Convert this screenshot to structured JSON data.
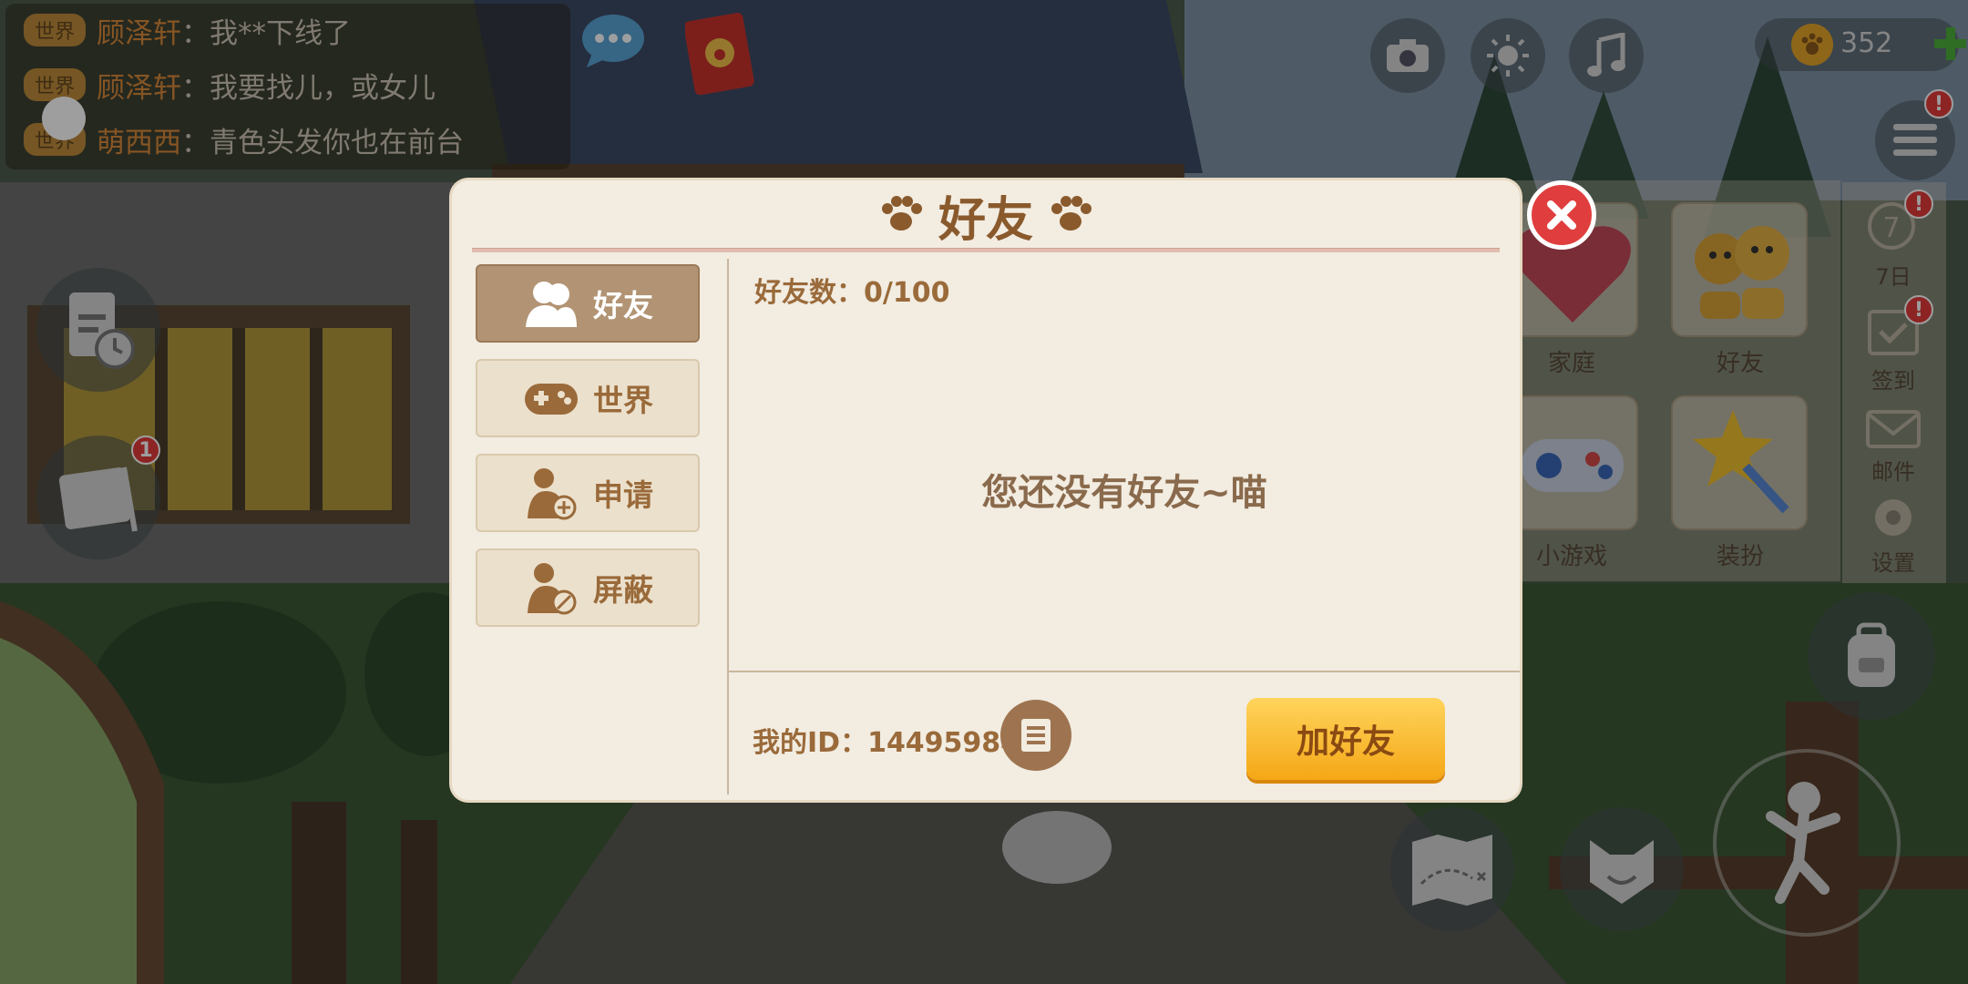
{
  "chat": {
    "lines": [
      {
        "channel": "世界",
        "name": "顾泽轩",
        "message": "我**下线了"
      },
      {
        "channel": "世界",
        "name": "顾泽轩",
        "message": "我要找儿，或女儿"
      },
      {
        "channel": "世界",
        "name": "萌西西",
        "message": "青色头发你也在前台"
      }
    ]
  },
  "hud": {
    "coins": "352",
    "notebook_badge": "1",
    "alert_mark": "!"
  },
  "right_menu": {
    "family_label": "家庭",
    "friends_label": "好友",
    "minigame_label": "小游戏",
    "dressup_label": "装扮",
    "side": {
      "seven_day": "7日",
      "checkin": "签到",
      "mail": "邮件",
      "settings": "设置"
    }
  },
  "dialog": {
    "title": "好友",
    "tabs": [
      {
        "label": "好友"
      },
      {
        "label": "世界"
      },
      {
        "label": "申请"
      },
      {
        "label": "屏蔽"
      }
    ],
    "friend_count": "好友数：0/100",
    "empty_message": "您还没有好友~喵",
    "my_id": "我的ID：14495984",
    "add_button": "加好友"
  },
  "colors": {
    "dialog_bg": "#f2ece1",
    "accent_brown": "#9a6a3a",
    "active_tab": "#b29474",
    "add_button": "#f5a716",
    "close_button": "#e03e3e"
  }
}
